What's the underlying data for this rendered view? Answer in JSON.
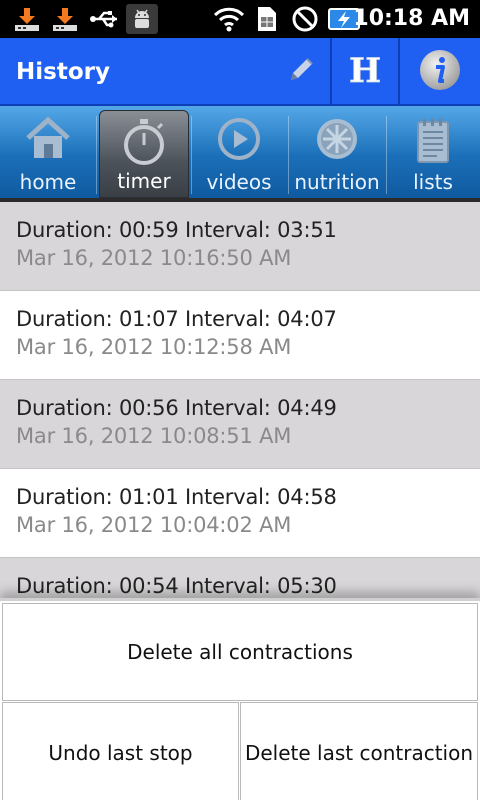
{
  "status_bar": {
    "time": "10:18 AM",
    "icons": [
      "download-icon",
      "download-icon",
      "usb-icon",
      "android-debug-icon",
      "wifi-icon",
      "sim-icon",
      "no-signal-icon",
      "battery-charging-icon"
    ]
  },
  "header": {
    "title": "History",
    "buttons": [
      "edit-icon",
      "help-h-icon",
      "info-icon"
    ]
  },
  "tabs": [
    {
      "label": "home",
      "icon": "home-icon",
      "active": false
    },
    {
      "label": "timer",
      "icon": "stopwatch-icon",
      "active": true
    },
    {
      "label": "videos",
      "icon": "play-icon",
      "active": false
    },
    {
      "label": "nutrition",
      "icon": "nutrition-icon",
      "active": false
    },
    {
      "label": "lists",
      "icon": "notepad-icon",
      "active": false
    }
  ],
  "history": [
    {
      "summary": "Duration: 00:59 Interval: 03:51",
      "timestamp": "Mar 16, 2012 10:16:50 AM"
    },
    {
      "summary": "Duration: 01:07 Interval: 04:07",
      "timestamp": "Mar 16, 2012 10:12:58 AM"
    },
    {
      "summary": "Duration: 00:56 Interval: 04:49",
      "timestamp": "Mar 16, 2012 10:08:51 AM"
    },
    {
      "summary": "Duration: 01:01 Interval: 04:58",
      "timestamp": "Mar 16, 2012 10:04:02 AM"
    },
    {
      "summary": "Duration: 00:54 Interval: 05:30",
      "timestamp": ""
    }
  ],
  "actions": {
    "delete_all": "Delete all contractions",
    "undo_last_stop": "Undo last stop",
    "delete_last": "Delete last contraction"
  },
  "colors": {
    "header_blue": "#1f5ff2",
    "tab_blue": "#1b6fb8",
    "row_grey": "#d8d6d8"
  }
}
